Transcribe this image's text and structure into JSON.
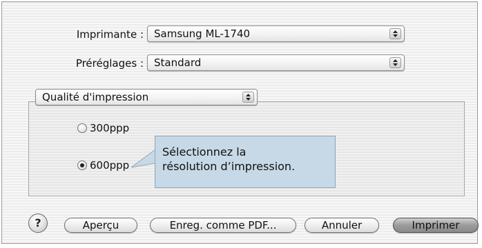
{
  "printer": {
    "label": "Imprimante :",
    "value": "Samsung ML-1740"
  },
  "presets": {
    "label": "Préréglages :",
    "value": "Standard"
  },
  "section": {
    "value": "Qualité d'impression"
  },
  "resolution": {
    "options": [
      {
        "label": "300ppp",
        "selected": false
      },
      {
        "label": "600ppp",
        "selected": true
      }
    ]
  },
  "callout": {
    "line1": "Sélectionnez la",
    "line2": "résolution d’impression."
  },
  "buttons": {
    "help": "?",
    "preview": "Aperçu",
    "save_pdf": "Enreg. comme PDF...",
    "cancel": "Annuler",
    "print": "Imprimer"
  }
}
